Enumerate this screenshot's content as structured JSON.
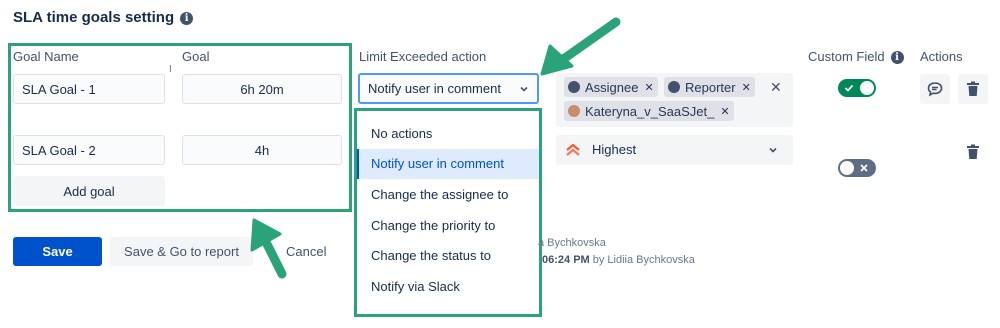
{
  "header": {
    "title": "SLA time goals setting",
    "info_icon": "info-icon"
  },
  "columns": {
    "goal_name": "Goal Name",
    "goal": "Goal",
    "limit_action": "Limit Exceeded action",
    "custom_field": "Custom Field",
    "actions": "Actions"
  },
  "goals": [
    {
      "name": "SLA Goal - 1",
      "time": "6h 20m"
    },
    {
      "name": "SLA Goal - 2",
      "time": "4h"
    }
  ],
  "add_goal_label": "Add goal",
  "limit_select": {
    "value": "Notify user in comment"
  },
  "dropdown": {
    "options": [
      "No actions",
      "Notify user in comment",
      "Change the assignee to",
      "Change the priority to",
      "Change the status to",
      "Notify via Slack"
    ],
    "selected_index": 1
  },
  "notify_users": [
    "Assignee",
    "Reporter",
    "Kateryna_v_SaaSJet_"
  ],
  "priority": {
    "value": "Highest",
    "color": "#ff5630"
  },
  "custom_field_toggles": [
    true,
    false
  ],
  "footer": {
    "save": "Save",
    "save_go": "Save & Go to report",
    "cancel": "Cancel",
    "meta_line1": "a Bychkovska",
    "meta_line2_time": "06:24 PM",
    "meta_line2_rest": " by Lidiia Bychkovska"
  },
  "colors": {
    "highlight": "#2aa37a",
    "primary": "#0052cc",
    "toggle_on": "#00875a",
    "toggle_off": "#5e6c84"
  }
}
